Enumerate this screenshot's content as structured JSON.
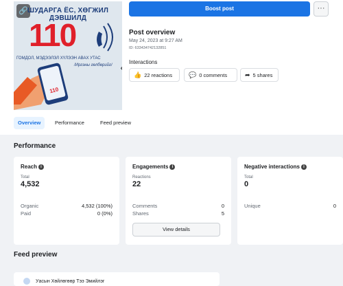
{
  "thumbnail": {
    "banner": "ШУДАРГА ЁС, ХӨГЖИЛ ДЭВШИЛД",
    "number": "110",
    "subtitle": "ГОМДОЛ, МЭДЭЭЛЭЛ ХҮЛЭЭН АВАХ УТАС",
    "caption": "/Иргэны гөлбөрийг/",
    "phone_screen_text": "110"
  },
  "header": {
    "boost_label": "Boost post",
    "more_label": "···"
  },
  "post_overview": {
    "title": "Post overview",
    "date": "May 24, 2023 at 9:27 AM",
    "id": "ID: 633434742132851",
    "interactions_label": "Interactions",
    "reactions": "22 reactions",
    "comments": "0 comments",
    "shares": "5 shares"
  },
  "tabs": [
    "Overview",
    "Performance",
    "Feed preview"
  ],
  "performance": {
    "title": "Performance",
    "reach": {
      "title": "Reach",
      "total_label": "Total",
      "total": "4,532",
      "rows": [
        {
          "label": "Organic",
          "value": "4,532 (100%)"
        },
        {
          "label": "Paid",
          "value": "0 (0%)"
        }
      ]
    },
    "engagements": {
      "title": "Engagements",
      "total_label": "Reactions",
      "total": "22",
      "rows": [
        {
          "label": "Comments",
          "value": "0"
        },
        {
          "label": "Shares",
          "value": "5"
        }
      ],
      "button": "View details"
    },
    "negative": {
      "title": "Negative interactions",
      "total_label": "Total",
      "total": "0",
      "rows": [
        {
          "label": "Unique",
          "value": "0"
        }
      ]
    }
  },
  "feed_preview": {
    "title": "Feed preview",
    "page_name": "Уасын Хөйлөгөөр Тээ Эмийлэг"
  },
  "colors": {
    "accent": "#1b74e4",
    "brand_red": "#e0202a"
  }
}
